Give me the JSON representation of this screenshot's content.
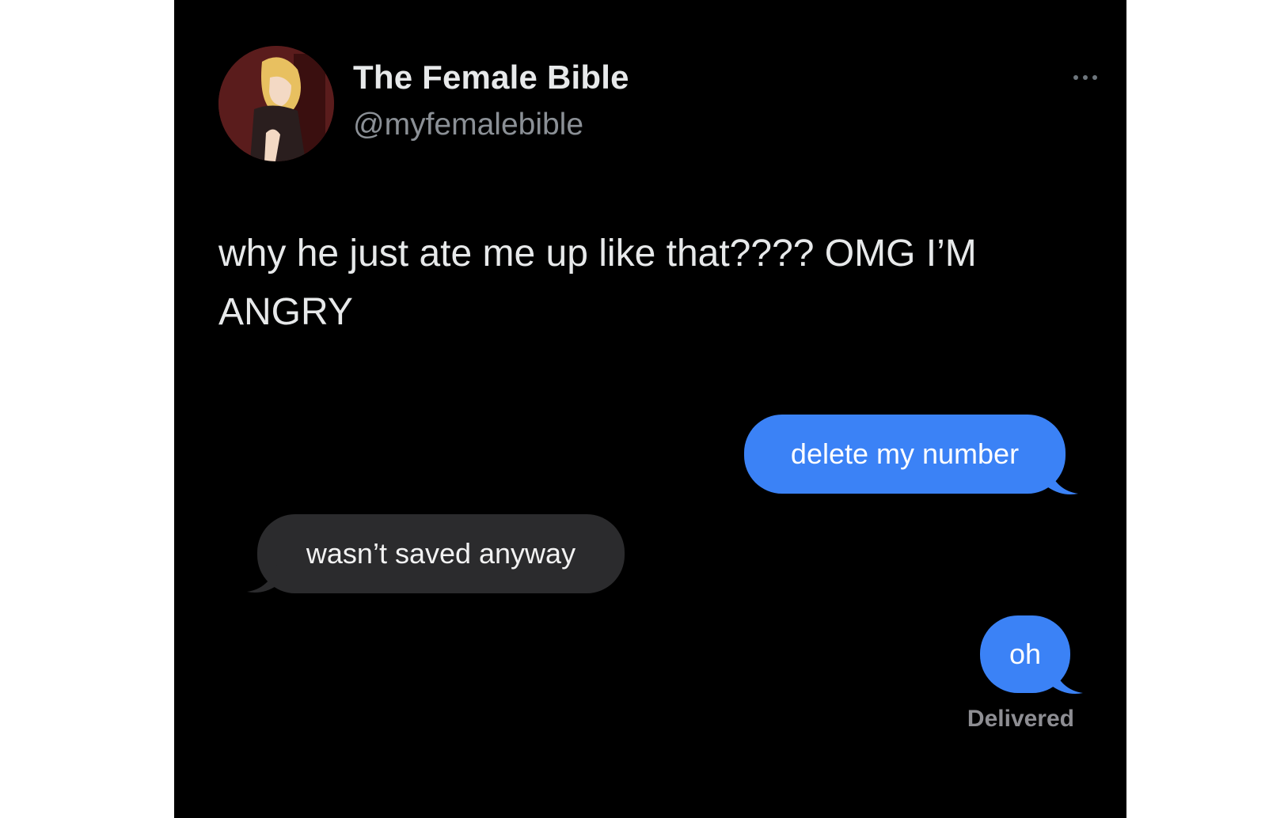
{
  "tweet": {
    "display_name": "The Female Bible",
    "handle": "@myfemalebible",
    "text": "why he just ate me up like that???? OMG I’M ANGRY"
  },
  "messages": [
    {
      "direction": "sent",
      "text": "delete my number"
    },
    {
      "direction": "received",
      "text": "wasn’t saved anyway"
    },
    {
      "direction": "sent",
      "text": "oh"
    }
  ],
  "status": {
    "delivered_label": "Delivered"
  },
  "colors": {
    "background": "#000000",
    "sent_bubble": "#3b82f6",
    "received_bubble": "#2b2b2d",
    "text_primary": "#e7e9ea",
    "text_secondary": "#8b9096"
  },
  "icons": {
    "avatar": "anime-girl-avatar",
    "more": "more-horizontal-icon"
  }
}
